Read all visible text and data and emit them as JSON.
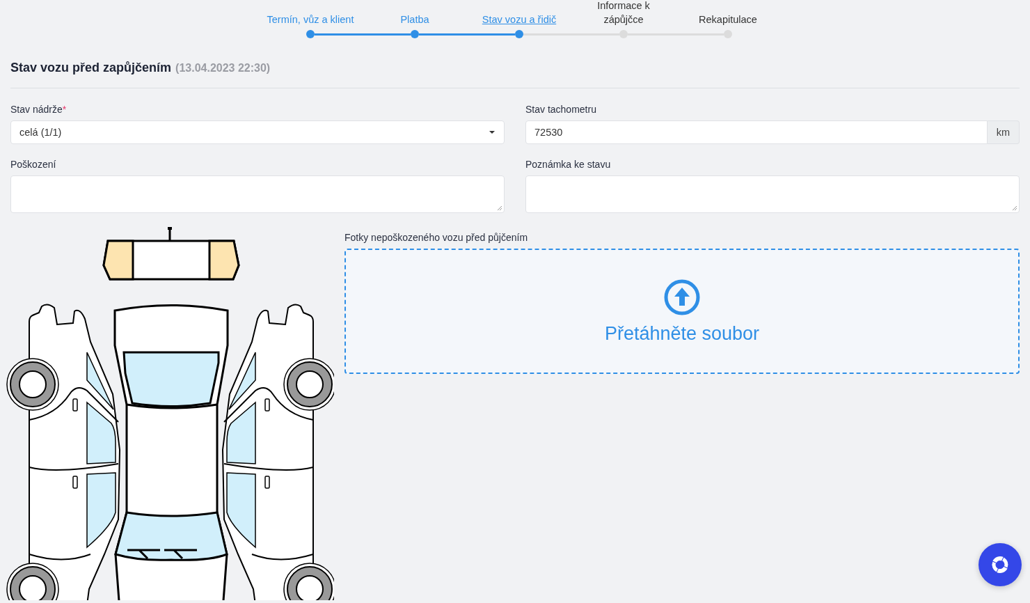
{
  "steps": [
    {
      "label": "Termín, vůz a klient",
      "done": true,
      "selected": false
    },
    {
      "label": "Platba",
      "done": true,
      "selected": false
    },
    {
      "label": "Stav vozu a řidič",
      "done": false,
      "selected": true
    },
    {
      "label": "Informace k zápůjčce",
      "done": false,
      "selected": false
    },
    {
      "label": "Rekapitulace",
      "done": false,
      "selected": false
    }
  ],
  "section": {
    "title": "Stav vozu před zapůjčením",
    "timestamp": "(13.04.2023 22:30)"
  },
  "fields": [
    {
      "kind": "select",
      "label": "Stav nádrže",
      "required_mark": "*",
      "value": "celá (1/1)"
    },
    {
      "kind": "unit",
      "label": "Stav tachometru",
      "value": "72530",
      "unit": "km"
    },
    {
      "kind": "textarea",
      "label": "Poškození"
    },
    {
      "kind": "textarea",
      "label": "Poznámka ke stavu"
    }
  ],
  "photos": {
    "label": "Fotky nepoškozeného vozu před půjčením",
    "dropzone_text": "Přetáhněte soubor"
  }
}
